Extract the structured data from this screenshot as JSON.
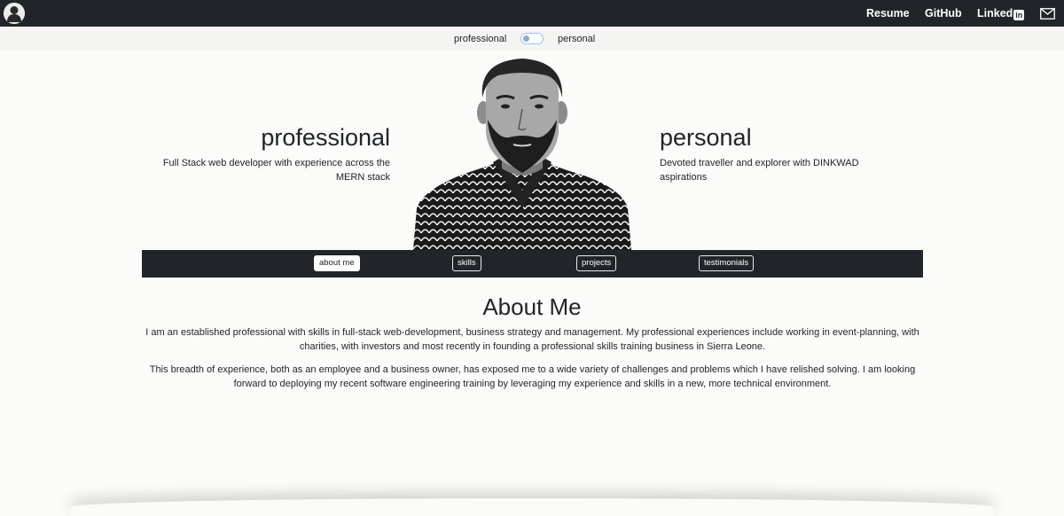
{
  "navbar": {
    "logo_icon": "silhouette-logo-icon",
    "links": {
      "resume": "Resume",
      "github": "GitHub",
      "linkedin_text": "Linked",
      "linkedin_box": "in"
    },
    "mail_icon": "mail-icon"
  },
  "toggle": {
    "left_label": "professional",
    "right_label": "personal",
    "state": "professional"
  },
  "hero": {
    "professional": {
      "title": "professional",
      "description": "Full Stack web developer with experience across the MERN stack"
    },
    "personal": {
      "title": "personal",
      "description": "Devoted traveller and explorer with DINKWAD aspirations"
    }
  },
  "tabs": [
    {
      "label": "about me",
      "active": true
    },
    {
      "label": "skills",
      "active": false
    },
    {
      "label": "projects",
      "active": false
    },
    {
      "label": "testimonials",
      "active": false
    }
  ],
  "about": {
    "title": "About Me",
    "paragraphs": [
      "I am an established professional with skills in full-stack web-development, business strategy and management. My professional experiences include working in event-planning, with charities, with investors and most recently in founding a professional skills training business in Sierra Leone.",
      "This breadth of experience, both as an employee and a business owner, has exposed me to a wide variety of challenges and problems which I have relished solving. I am looking forward to deploying my recent software engineering training by leveraging my experience and skills in a new, more technical environment."
    ]
  },
  "colors": {
    "navbar_bg": "#212529",
    "page_bg": "#fbfbf9",
    "toggle_accent": "#9dc0f5"
  }
}
